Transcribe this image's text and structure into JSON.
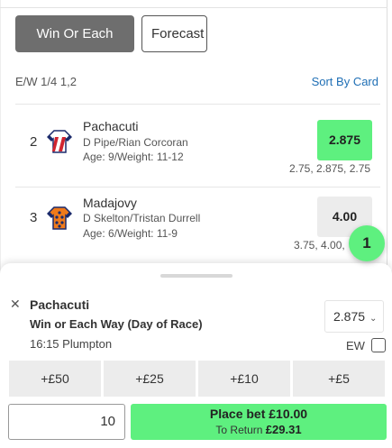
{
  "tabs": [
    {
      "label": "Win Or Each Way",
      "active": true
    },
    {
      "label": "Forecast",
      "active": false
    }
  ],
  "terms": {
    "text": "E/W 1/4 1,2"
  },
  "sort": {
    "label": "Sort By Card"
  },
  "runners": [
    {
      "number": "2",
      "name": "Pachacuti",
      "connections": "D Pipe/Rian Corcoran",
      "age_weight": "Age: 9/Weight: 11-12",
      "price": "2.875",
      "price_selected": true,
      "price_history": "2.75, 2.875, 2.75",
      "silk_icon": "jockey-silk-white-red-stripes-icon"
    },
    {
      "number": "3",
      "name": "Madajovy",
      "connections": "D Skelton/Tristan Durrell",
      "age_weight": "Age: 6/Weight: 11-9",
      "price": "4.00",
      "price_selected": false,
      "price_history": "3.75, 4.00,",
      "silk_icon": "jockey-silk-orange-navy-icon"
    }
  ],
  "slip_count": "1",
  "betslip": {
    "runner": "Pachacuti",
    "market": "Win or Each Way (Day of Race)",
    "race": "16:15 Plumpton",
    "odds": "2.875",
    "ew_label": "EW",
    "ew_checked": false,
    "stakes": [
      "+£50",
      "+£25",
      "+£10",
      "+£5"
    ],
    "stake_value": "10",
    "place_label": "Place bet £10.00",
    "return_prefix": "To Return",
    "return_value": "£29.31"
  },
  "colors": {
    "accent_green": "#5ef07f",
    "link_blue": "#1f6fb5",
    "tab_active": "#6e6e6e"
  }
}
